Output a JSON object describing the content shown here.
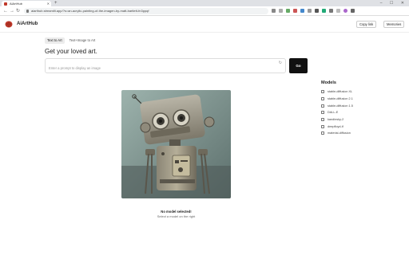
{
  "browser": {
    "tab_title": "AiArtHub",
    "new_tab_symbol": "+",
    "window_controls": "– ☐ ✕",
    "url": "aiarthub.streamlit.app/?s=an-acrylic-painting-of-the-imagen-by-matt-bartlett-fn3ppqf",
    "nav_back": "←",
    "nav_forward": "→",
    "nav_reload": "↻"
  },
  "header": {
    "brand": "AiArtHub",
    "copy_link_label": "Copy link",
    "memories_label": "Memories"
  },
  "tabs": [
    "Text to Art",
    "Text+Image to Art"
  ],
  "main": {
    "heading": "Get your loved art.",
    "prompt_placeholder": "Enter a prompt to display an image",
    "go_label": "Go",
    "status_title": "No model selected!",
    "status_subtitle": "Select a model on the right"
  },
  "models": {
    "title": "Models",
    "items": [
      "stable-diffusion XL",
      "stable-diffusion 2.1",
      "stable-diffusion 1.5",
      "DALL-E",
      "kandinsky-2",
      "deepfloyd-if",
      "material-diffusion"
    ]
  },
  "colors": {
    "accent": "#111111",
    "brand": "#c0392b"
  },
  "icons": {
    "logo": "brain-logo-icon",
    "refresh": "refresh-icon"
  }
}
